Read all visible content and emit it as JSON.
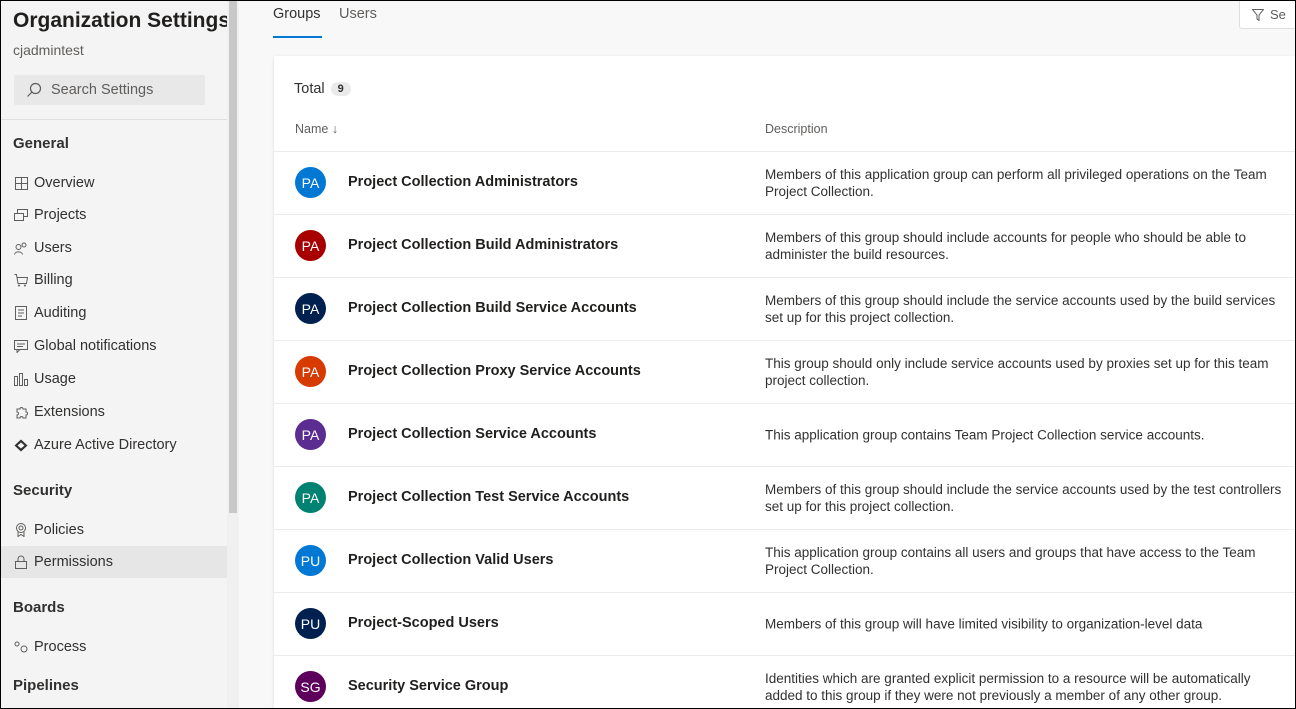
{
  "sidebar": {
    "title": "Organization Settings",
    "subtitle": "cjadmintest",
    "search_placeholder": "Search Settings",
    "sections": {
      "general": "General",
      "security": "Security",
      "boards": "Boards",
      "pipelines": "Pipelines"
    },
    "items": {
      "overview": "Overview",
      "projects": "Projects",
      "users": "Users",
      "billing": "Billing",
      "auditing": "Auditing",
      "global_notifications": "Global notifications",
      "usage": "Usage",
      "extensions": "Extensions",
      "aad": "Azure Active Directory",
      "policies": "Policies",
      "permissions": "Permissions",
      "process": "Process"
    }
  },
  "tabs": {
    "groups": "Groups",
    "users": "Users"
  },
  "filter_label": "Se",
  "table": {
    "total_label": "Total",
    "total_count": "9",
    "col_name": "Name ↓",
    "col_description": "Description",
    "rows": [
      {
        "initials": "PA",
        "color": "#0078d4",
        "name": "Project Collection Administrators",
        "description": "Members of this application group can perform all privileged operations on the Team Project Collection."
      },
      {
        "initials": "PA",
        "color": "#a80000",
        "name": "Project Collection Build Administrators",
        "description": "Members of this group should include accounts for people who should be able to administer the build resources."
      },
      {
        "initials": "PA",
        "color": "#002050",
        "name": "Project Collection Build Service Accounts",
        "description": "Members of this group should include the service accounts used by the build services set up for this project collection."
      },
      {
        "initials": "PA",
        "color": "#d83b01",
        "name": "Project Collection Proxy Service Accounts",
        "description": "This group should only include service accounts used by proxies set up for this team project collection."
      },
      {
        "initials": "PA",
        "color": "#5c2d91",
        "name": "Project Collection Service Accounts",
        "description": "This application group contains Team Project Collection service accounts."
      },
      {
        "initials": "PA",
        "color": "#008272",
        "name": "Project Collection Test Service Accounts",
        "description": "Members of this group should include the service accounts used by the test controllers set up for this project collection."
      },
      {
        "initials": "PU",
        "color": "#0078d4",
        "name": "Project Collection Valid Users",
        "description": "This application group contains all users and groups that have access to the Team Project Collection."
      },
      {
        "initials": "PU",
        "color": "#002050",
        "name": "Project-Scoped Users",
        "description": "Members of this group will have limited visibility to organization-level data"
      },
      {
        "initials": "SG",
        "color": "#5c005c",
        "name": "Security Service Group",
        "description": "Identities which are granted explicit permission to a resource will be automatically added to this group if they were not previously a member of any other group."
      }
    ]
  }
}
